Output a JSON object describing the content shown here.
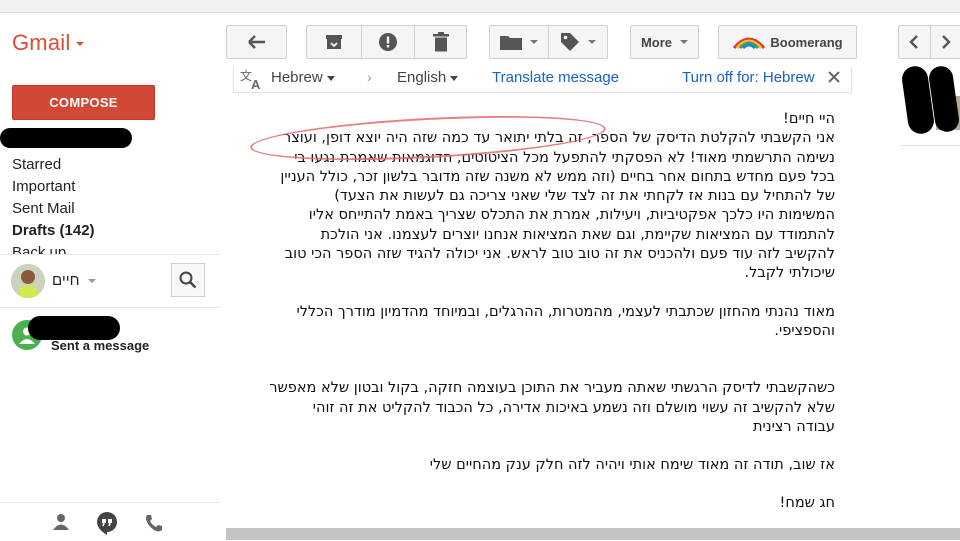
{
  "app": {
    "name": "Gmail"
  },
  "toolbar": {
    "more_label": "More",
    "boomerang_label": "Boomerang"
  },
  "sidebar": {
    "compose_label": "COMPOSE",
    "items": [
      "Starred",
      "Important",
      "Sent Mail",
      "Drafts (142)",
      "Back up"
    ]
  },
  "hangouts": {
    "user_name": "חיים",
    "status": "Sent a message"
  },
  "translate": {
    "from_lang": "Hebrew",
    "to_lang": "English",
    "translate_link": "Translate message",
    "turn_off_link": "Turn off for: Hebrew"
  },
  "message": {
    "paragraphs": [
      [
        "היי חיים!",
        "אני הקשבתי להקלטת הדיסק של הספר, זה בלתי יתואר עד כמה שזה היה יוצא דופן, ועוצר",
        "נשימה התרשמתי מאוד! לא הפסקתי להתפעל מכל הציטוטים, הדוגמאות שאמרת נגעו בי",
        "בכל פעם מחדש בתחום אחר בחיים (וזה ממש לא משנה שזה מדובר בלשון זכר, כולל העניין",
        "של להתחיל עם בנות אז לקחתי את זה לצד שלי שאני צריכה גם לעשות את הצעד)",
        "המשימות היו כלכך אפקטיביות, ויעילות, אמרת את התכלס שצריך באמת להתייחס אליו",
        "להתמודד עם המציאות שקיימת, וגם שאת המציאות  אנחנו יוצרים לעצמנו. אני הולכת",
        "להקשיב לזה עוד פעם ולהכניס את זה טוב טוב לראש. אני יכולה להגיד שזה הספר הכי טוב",
        "שיכולתי לקבל."
      ],
      [
        "מאוד נהנתי מהחזון שכתבתי לעצמי, מהמטרות, ההרגלים, ובמיוחד מהדמיון מודרך הכללי",
        "והספציפי."
      ],
      [
        "כשהקשבתי לדיסק הרגשתי שאתה מעביר את התוכן בעוצמה חזקה, בקול ובטון שלא מאפשר",
        "שלא להקשיב זה עשוי מושלם וזה נשמע באיכות אדירה, כל הכבוד להקליט את זה זוהי",
        "עבודה רצינית"
      ],
      [
        "אז שוב, תודה זה מאוד שימח אותי ויהיה לזה חלק ענק מהחיים שלי"
      ],
      [
        "חג שמח!"
      ]
    ]
  },
  "colors": {
    "brand_red": "#dd4b39",
    "compose_red": "#d14836",
    "link_blue": "#1a62c4",
    "annotation_red": "#e06a6a"
  },
  "icons": [
    "reply-icon",
    "archive-icon",
    "spam-icon",
    "delete-icon",
    "folder-icon",
    "label-icon",
    "boomerang-icon",
    "chevron-left-icon",
    "chevron-right-icon",
    "search-icon",
    "translate-icon",
    "close-icon",
    "person-icon",
    "hangouts-icon",
    "phone-icon"
  ]
}
